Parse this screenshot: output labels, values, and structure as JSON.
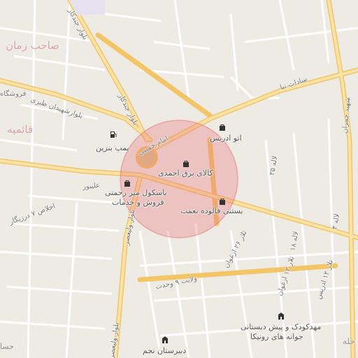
{
  "map": {
    "highlight_color": "#e8707a",
    "road_color": "#f5cf73",
    "background_color": "#eeebe4",
    "district_labels": [
      {
        "id": "sahebzaman",
        "text": "صاحب زمان"
      },
      {
        "id": "ghaemieh",
        "text": "قائمیه"
      },
      {
        "id": "hesam",
        "text": "حسا"
      },
      {
        "id": "kheh",
        "text": "خله"
      }
    ],
    "street_labels": [
      {
        "id": "jandakar-top",
        "text": "بلوار جندکار"
      },
      {
        "id": "jandakar",
        "text": "بلوار جندکار"
      },
      {
        "id": "tabari",
        "text": "بلوارشهیدان طبری"
      },
      {
        "id": "sadat",
        "text": "سادات نیا"
      },
      {
        "id": "elmikh",
        "text": "اخلاص ۷ درزیگار"
      },
      {
        "id": "alibor",
        "text": "علیبور"
      },
      {
        "id": "valiasr",
        "text": "بلوار ولیعصر"
      },
      {
        "id": "valiasr-bottom",
        "text": "بلوار ولیعصر"
      },
      {
        "id": "velayat",
        "text": "ولایت ۹ وحدت"
      },
      {
        "id": "tala26",
        "text": "تلار ۲۶ ارغوان"
      },
      {
        "id": "tala12",
        "text": "تلار ۱۲ ارغوان"
      },
      {
        "id": "talar",
        "text": "تلار ۱۲ ادریس"
      },
      {
        "id": "imam",
        "text": "امام خمینی"
      },
      {
        "id": "l25",
        "text": "لاله ۲۵"
      },
      {
        "id": "l18",
        "text": "لاله ۱۸"
      },
      {
        "id": "l4",
        "text": "لاله ۴"
      },
      {
        "id": "right-ver",
        "text": "شهید چمران"
      },
      {
        "id": "furoshgah",
        "text": "فروشگاه"
      }
    ],
    "pois": [
      {
        "id": "atu-edris",
        "text": "اتو ادریس",
        "icon": "shopping-bag-icon"
      },
      {
        "id": "pump",
        "text": "پمپ بنزین",
        "icon": "fuel-pump-icon"
      },
      {
        "id": "kalaye-barq",
        "text": "کالای برق احمدی",
        "icon": "shopping-bag-icon"
      },
      {
        "id": "basekool",
        "text": "باسکول میر رحمتی",
        "icon": "shopping-bag-icon"
      },
      {
        "id": "basekool2",
        "text": "فروش و خدمات"
      },
      {
        "id": "bastani",
        "text": "بستنی فالوده نعمت",
        "icon": "shopping-bag-icon"
      },
      {
        "id": "mahd",
        "text": "مهدکودک و پیش دبستانی",
        "icon": "school-icon"
      },
      {
        "id": "mahd2",
        "text": "جوانه های رونیکا"
      },
      {
        "id": "dabirestan",
        "text": "دبیرستان نجم",
        "icon": "school-icon"
      }
    ]
  }
}
